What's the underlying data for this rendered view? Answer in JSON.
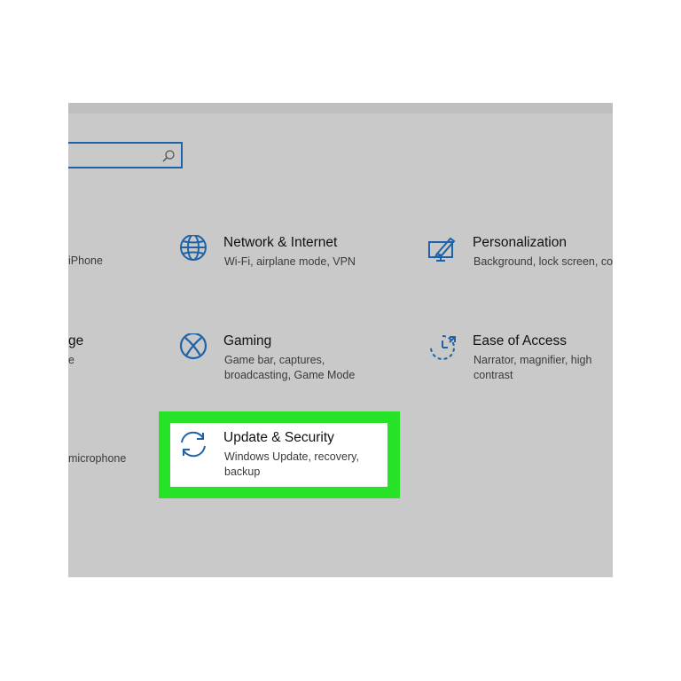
{
  "search": {
    "placeholder": ""
  },
  "tiles": {
    "network": {
      "title": "Network & Internet",
      "description": "Wi-Fi, airplane mode, VPN",
      "icon": "globe-icon"
    },
    "personalization": {
      "title": "Personalization",
      "description": "Background, lock screen, col",
      "icon": "personalization-icon"
    },
    "gaming": {
      "title": "Gaming",
      "description_line1": "Game bar, captures,",
      "description_line2": "broadcasting, Game Mode",
      "icon": "xbox-icon"
    },
    "ease_of_access": {
      "title": "Ease of Access",
      "description_line1": "Narrator, magnifier, high",
      "description_line2": "contrast",
      "icon": "ease-of-access-icon"
    },
    "update_security": {
      "title": "Update & Security",
      "description_line1": "Windows Update, recovery,",
      "description_line2": "backup",
      "icon": "sync-icon"
    }
  },
  "partial_left": {
    "row1_desc": "iPhone",
    "row2_title": "ge",
    "row2_desc": "e",
    "row3_desc": "microphone"
  },
  "colors": {
    "accent": "#1e63a8",
    "highlight": "#27e327",
    "panel_background": "#c9c9c9"
  }
}
